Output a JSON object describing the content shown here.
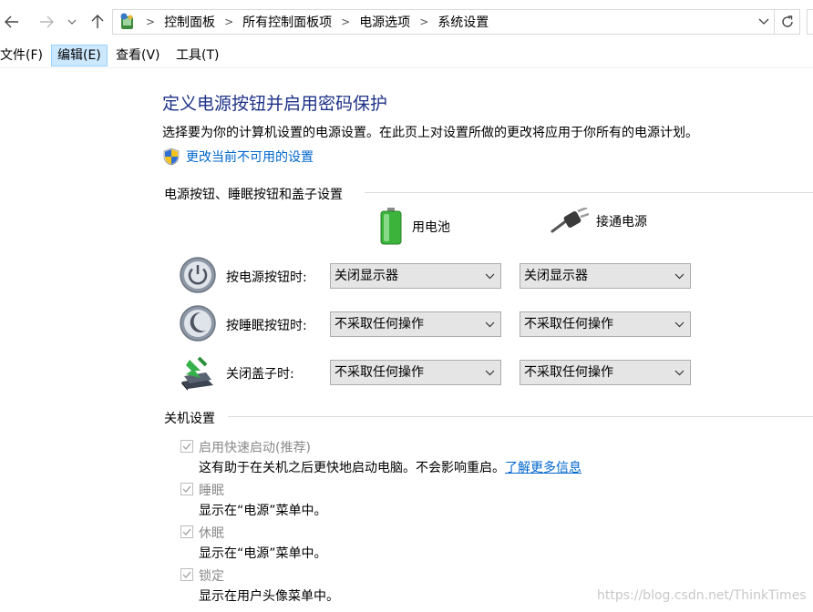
{
  "nav": {
    "breadcrumbs": [
      "控制面板",
      "所有控制面板项",
      "电源选项",
      "系统设置"
    ]
  },
  "menu": [
    {
      "label": "文件(F)",
      "active": false
    },
    {
      "label": "编辑(E)",
      "active": true
    },
    {
      "label": "查看(V)",
      "active": false
    },
    {
      "label": "工具(T)",
      "active": false
    }
  ],
  "page": {
    "title": "定义电源按钮并启用密码保护",
    "description": "选择要为你的计算机设置的电源设置。在此页上对设置所做的更改将应用于你所有的电源计划。",
    "change_link": "更改当前不可用的设置"
  },
  "power_section": {
    "header": "电源按钮、睡眠按钮和盖子设置",
    "col_battery": "用电池",
    "col_plugged": "接通电源",
    "rows": [
      {
        "icon": "power-button-icon",
        "label": "按电源按钮时:",
        "battery": "关闭显示器",
        "plugged": "关闭显示器"
      },
      {
        "icon": "sleep-button-icon",
        "label": "按睡眠按钮时:",
        "battery": "不采取任何操作",
        "plugged": "不采取任何操作"
      },
      {
        "icon": "laptop-lid-icon",
        "label": "关闭盖子时:",
        "battery": "不采取任何操作",
        "plugged": "不采取任何操作"
      }
    ]
  },
  "shutdown_section": {
    "header": "关机设置",
    "fast_startup": {
      "label": "启用快速启动(推荐)",
      "desc": "这有助于在关机之后更快地启动电脑。不会影响重启。",
      "link": "了解更多信息",
      "checked": true
    },
    "sleep": {
      "label": "睡眠",
      "desc": "显示在“电源”菜单中。",
      "checked": true
    },
    "hibernate": {
      "label": "休眠",
      "desc": "显示在“电源”菜单中。",
      "checked": true
    },
    "lock": {
      "label": "锁定",
      "desc": "显示在用户头像菜单中。",
      "checked": true
    }
  },
  "watermark": "https://blog.csdn.net/ThinkTimes",
  "colors": {
    "title": "#1e3287",
    "link": "#0066cc",
    "menu_active_bg": "#cce8ff",
    "battery_green": "#3cb43c"
  }
}
